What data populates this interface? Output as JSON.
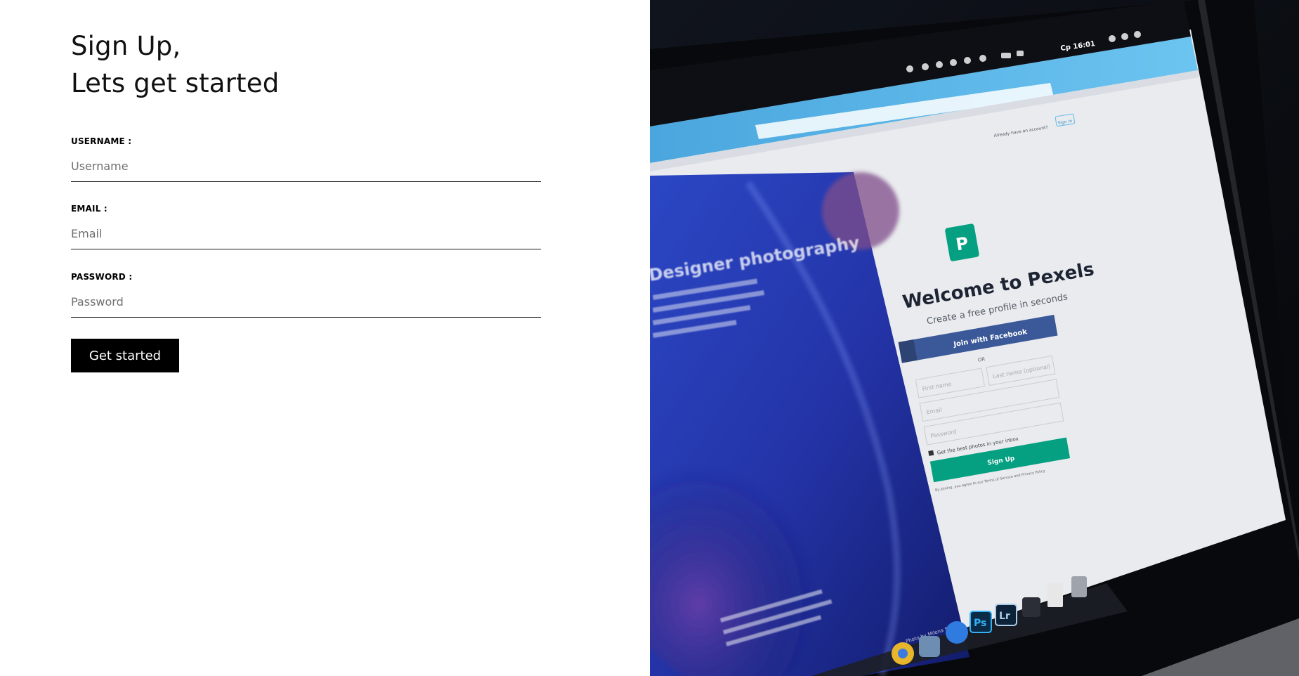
{
  "form": {
    "title_line1": "Sign Up,",
    "title_line2": "Lets get started",
    "fields": [
      {
        "label": "USERNAME :",
        "placeholder": "Username",
        "value": ""
      },
      {
        "label": "EMAIL :",
        "placeholder": "Email",
        "value": ""
      },
      {
        "label": "PASSWORD :",
        "placeholder": "Password",
        "value": ""
      }
    ],
    "submit_label": "Get started"
  },
  "photo": {
    "screen_heading": "Welcome to Pexels",
    "screen_subheading": "Create a free profile in seconds",
    "facebook_button": "Join with Facebook",
    "or_text": "OR",
    "first_name_placeholder": "First name",
    "last_name_placeholder": "Last name (optional)",
    "email_placeholder": "Email",
    "password_placeholder": "Password",
    "checkbox_text": "Get the best photos in your inbox",
    "signup_button": "Sign Up",
    "terms_text": "By joining, you agree to our Terms of Service and Privacy Policy",
    "already_text": "Already have an account?",
    "signin_text": "Sign in",
    "menubar_time": "Cp 16:01",
    "blurred_heading": "Designer photography",
    "photo_credit": "Photo by Milena Santos",
    "dock_ps": "Ps",
    "dock_lr": "Lr"
  },
  "colors": {
    "button_bg": "#000000",
    "button_text": "#ffffff",
    "pexels_green": "#05a081",
    "facebook_blue": "#3b5998",
    "browser_blue": "#5db8ea"
  }
}
